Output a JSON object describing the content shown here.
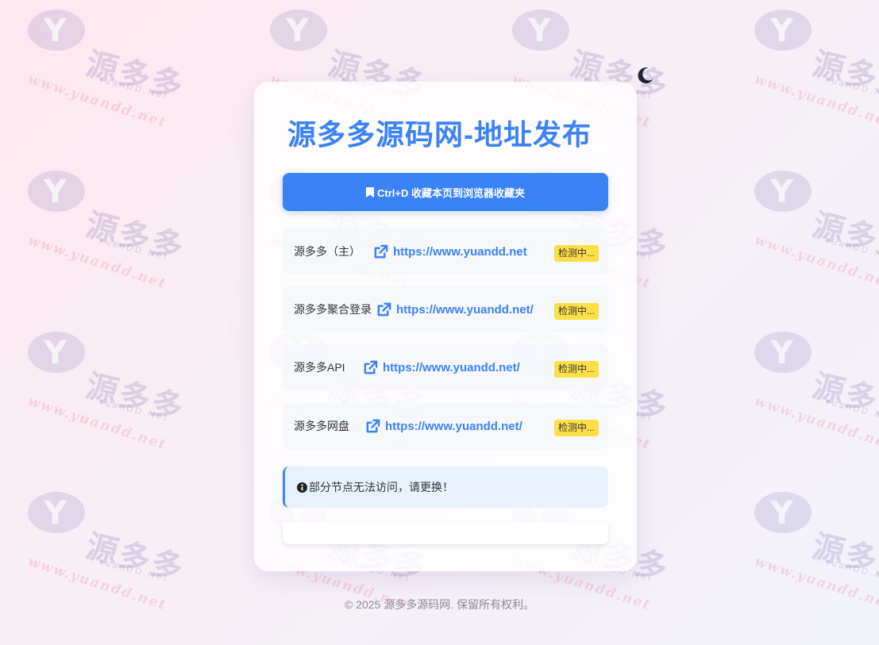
{
  "page": {
    "title": "源多多源码网-地址发布",
    "bookmark_label": "Ctrl+D 收藏本页到浏览器收藏夹",
    "notice_text": "部分节点无法访问，请更换！",
    "footer": "© 2025 源多多源码网. 保留所有权利。",
    "accent_color": "#3b82f6",
    "status_color": "#fde047"
  },
  "links": [
    {
      "name": "源多多（主）",
      "url": "https://www.yuandd.net",
      "status": "检测中..."
    },
    {
      "name": "源多多聚合登录",
      "url": "https://www.yuandd.net/",
      "status": "检测中..."
    },
    {
      "name": "源多多API",
      "url": "https://www.yuandd.net/",
      "status": "检测中..."
    },
    {
      "name": "源多多网盘",
      "url": "https://www.yuandd.net/",
      "status": "检测中..."
    }
  ],
  "watermark": {
    "brand": "源多多",
    "sub": "YuanDD.Net",
    "url": "www.yuandd.net"
  },
  "icons": {
    "theme_toggle": "moon-icon",
    "bookmark": "bookmark-icon",
    "external_link": "external-link-icon",
    "notice": "info-circle-icon"
  }
}
